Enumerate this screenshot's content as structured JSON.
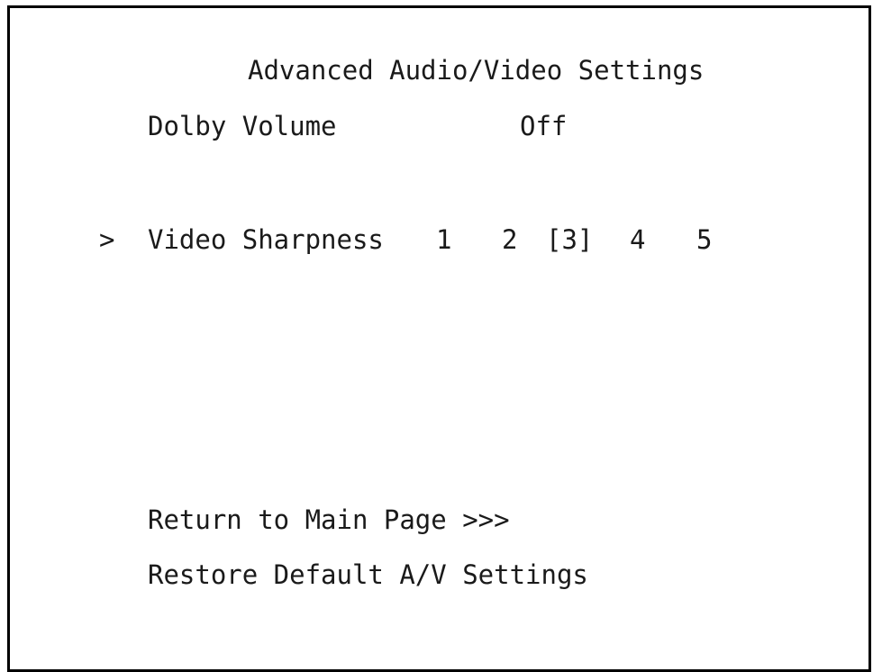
{
  "screen": {
    "title": "Advanced Audio/Video Settings"
  },
  "settings": {
    "dolby_volume": {
      "label": "Dolby Volume",
      "value": "Off"
    },
    "video_sharpness": {
      "cursor": ">",
      "label": "Video Sharpness",
      "options": [
        "1",
        "2",
        "[3]",
        "4",
        "5"
      ],
      "selected": 3
    }
  },
  "actions": {
    "return_label": "Return to Main Page >>>",
    "restore_label": "Restore Default A/V Settings"
  }
}
